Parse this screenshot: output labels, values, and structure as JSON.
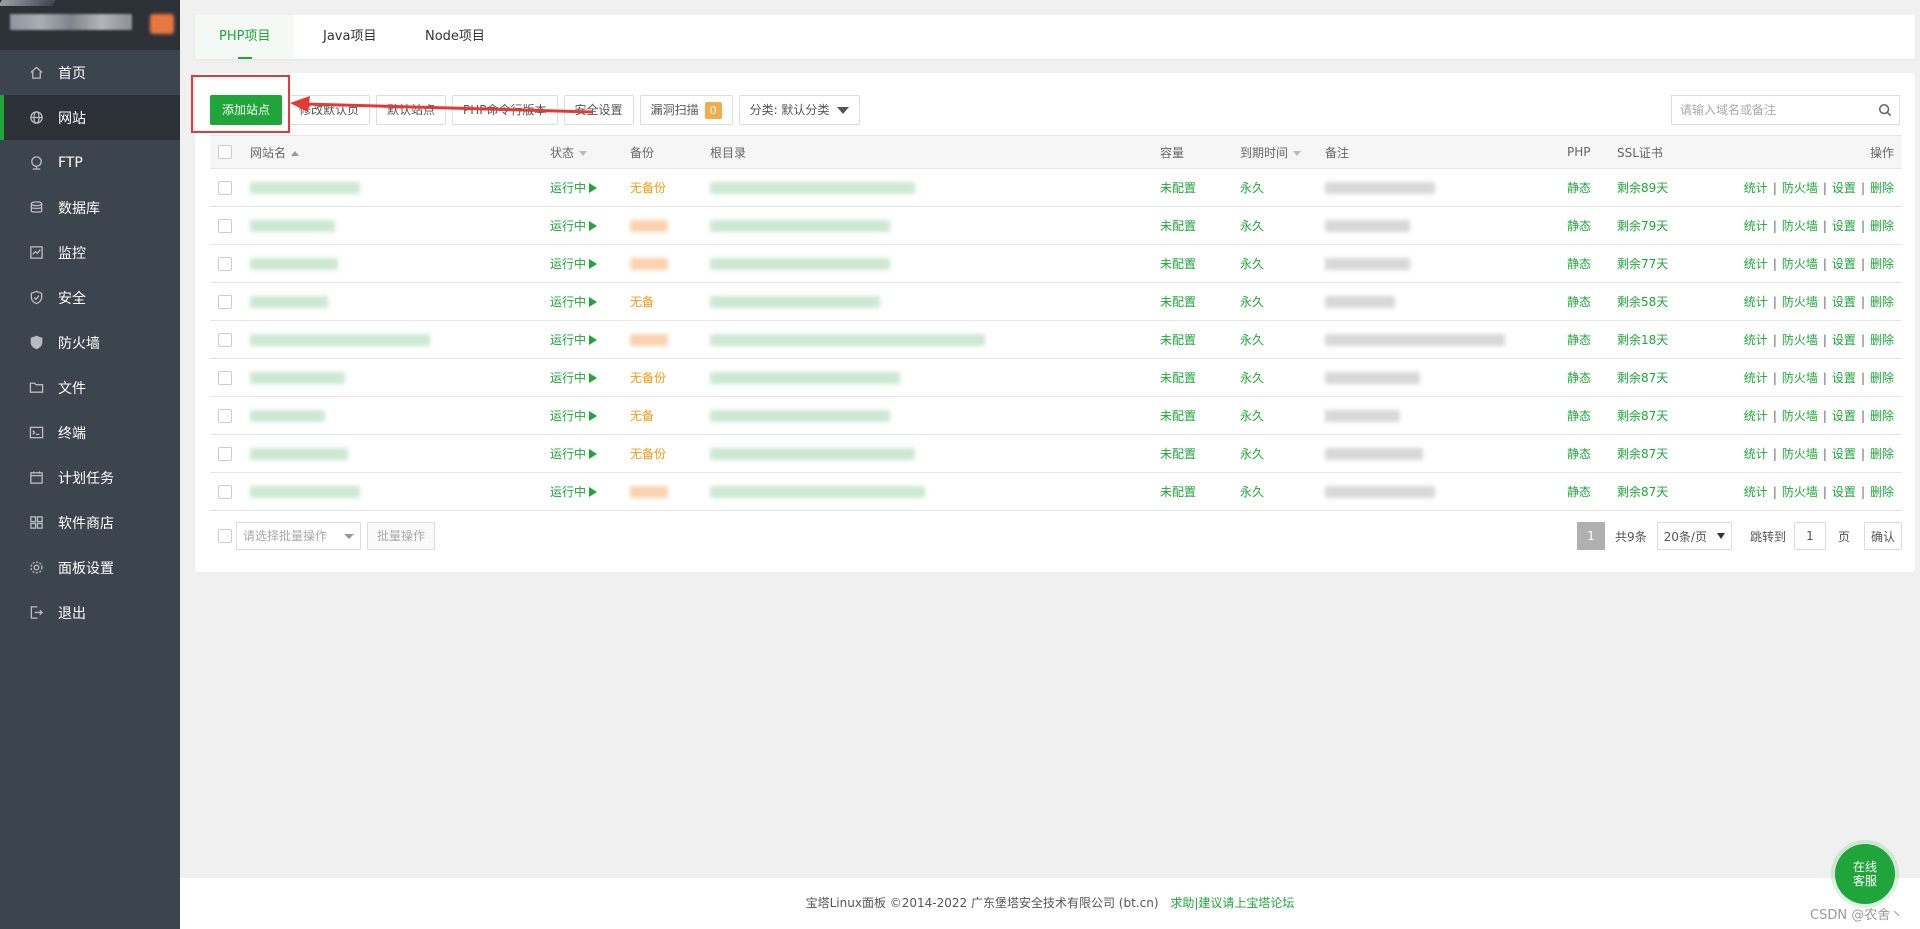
{
  "sidebar": {
    "items": [
      {
        "label": "首页",
        "icon": "home-icon",
        "active": false
      },
      {
        "label": "网站",
        "icon": "globe-icon",
        "active": true
      },
      {
        "label": "FTP",
        "icon": "ftp-icon",
        "active": false
      },
      {
        "label": "数据库",
        "icon": "database-icon",
        "active": false
      },
      {
        "label": "监控",
        "icon": "monitor-icon",
        "active": false
      },
      {
        "label": "安全",
        "icon": "shield-icon",
        "active": false
      },
      {
        "label": "防火墙",
        "icon": "firewall-icon",
        "active": false
      },
      {
        "label": "文件",
        "icon": "folder-icon",
        "active": false
      },
      {
        "label": "终端",
        "icon": "terminal-icon",
        "active": false
      },
      {
        "label": "计划任务",
        "icon": "calendar-icon",
        "active": false
      },
      {
        "label": "软件商店",
        "icon": "grid-icon",
        "active": false
      },
      {
        "label": "面板设置",
        "icon": "gear-icon",
        "active": false
      },
      {
        "label": "退出",
        "icon": "logout-icon",
        "active": false
      }
    ]
  },
  "tabs": [
    {
      "label": "PHP项目",
      "active": true
    },
    {
      "label": "Java项目",
      "active": false
    },
    {
      "label": "Node项目",
      "active": false
    }
  ],
  "toolbar": {
    "add_site": "添加站点",
    "modify_default_page": "修改默认页",
    "default_site": "默认站点",
    "php_cli_version": "PHP命令行版本",
    "security_settings": "安全设置",
    "vuln_scan": "漏洞扫描",
    "vuln_scan_count": "0",
    "category": "分类: 默认分类"
  },
  "search": {
    "placeholder": "请输入域名或备注"
  },
  "table": {
    "headers": {
      "site_name": "网站名",
      "status": "状态",
      "backup": "备份",
      "root_dir": "根目录",
      "capacity": "容量",
      "expiry": "到期时间",
      "note": "备注",
      "php": "PHP",
      "ssl": "SSL证书",
      "ops": "操作"
    },
    "rows": [
      {
        "status": "运行中",
        "backup": "无备份",
        "capacity": "未配置",
        "expiry": "永久",
        "php": "静态",
        "ssl": "剩余89天"
      },
      {
        "status": "运行中",
        "backup": "",
        "capacity": "未配置",
        "expiry": "永久",
        "php": "静态",
        "ssl": "剩余79天"
      },
      {
        "status": "运行中",
        "backup": "",
        "capacity": "未配置",
        "expiry": "永久",
        "php": "静态",
        "ssl": "剩余77天"
      },
      {
        "status": "运行中",
        "backup": "无备",
        "capacity": "未配置",
        "expiry": "永久",
        "php": "静态",
        "ssl": "剩余58天"
      },
      {
        "status": "运行中",
        "backup": "",
        "capacity": "未配置",
        "expiry": "永久",
        "php": "静态",
        "ssl": "剩余18天"
      },
      {
        "status": "运行中",
        "backup": "无备份",
        "capacity": "未配置",
        "expiry": "永久",
        "php": "静态",
        "ssl": "剩余87天"
      },
      {
        "status": "运行中",
        "backup": "无备",
        "capacity": "未配置",
        "expiry": "永久",
        "php": "静态",
        "ssl": "剩余87天"
      },
      {
        "status": "运行中",
        "backup": "无备份",
        "capacity": "未配置",
        "expiry": "永久",
        "php": "静态",
        "ssl": "剩余87天"
      },
      {
        "status": "运行中",
        "backup": "",
        "capacity": "未配置",
        "expiry": "永久",
        "php": "静态",
        "ssl": "剩余87天"
      }
    ],
    "ops": [
      "统计",
      "防火墙",
      "设置",
      "删除"
    ]
  },
  "bottom": {
    "bulk_placeholder": "请选择批量操作",
    "bulk_button": "批量操作",
    "page_current": "1",
    "total": "共9条",
    "per_page": "20条/页",
    "jump_label": "跳转到",
    "jump_value": "1",
    "page_unit": "页",
    "confirm": "确认"
  },
  "footer": {
    "copyright": "宝塔Linux面板 ©2014-2022 广东堡塔安全技术有限公司 (bt.cn)",
    "help_link": "求助|建议请上宝塔论坛"
  },
  "help_button": {
    "line1": "在线",
    "line2": "客服"
  },
  "watermark": "CSDN @农舍丶",
  "colors": {
    "accent": "#20a53a",
    "warning": "#f39c12",
    "sidebar_bg": "#3c444d",
    "annotation": "#e53935"
  }
}
